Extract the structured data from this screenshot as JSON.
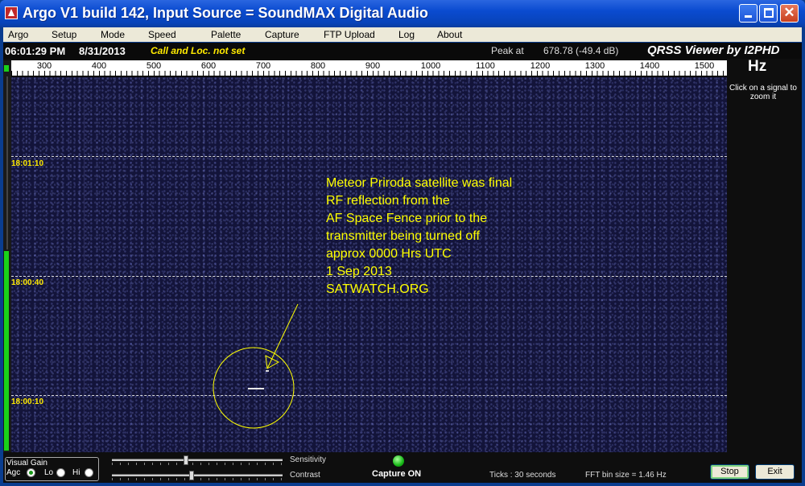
{
  "window": {
    "title": "Argo V1 build 142, Input Source = SoundMAX Digital Audio",
    "minimize_icon": "minimize-icon",
    "maximize_icon": "maximize-icon",
    "close_icon": "close-icon",
    "close_glyph": "✕"
  },
  "menu": {
    "items": [
      "Argo",
      "Setup",
      "Mode",
      "Speed",
      "Palette",
      "Capture",
      "FTP Upload",
      "Log",
      "About"
    ]
  },
  "status": {
    "time": "06:01:29 PM",
    "date": "8/31/2013",
    "call": "Call and Loc. not set",
    "peak_label": "Peak at",
    "peak_value": "678.78 (-49.4 dB)",
    "viewer": "QRSS Viewer by I2PHD"
  },
  "ruler": {
    "labels": [
      "300",
      "400",
      "500",
      "600",
      "700",
      "800",
      "900",
      "1000",
      "1100",
      "1200",
      "1300",
      "1400",
      "1500"
    ],
    "unit": "Hz",
    "hint": "Click on a signal to zoom it"
  },
  "waterfall": {
    "time_marks": [
      "18:01:10",
      "18:00:40",
      "18:00:10"
    ],
    "annotation_lines": [
      "Meteor Priroda satellite was final",
      "RF reflection from the",
      "AF Space Fence prior to the",
      "transmitter being turned off",
      "approx 0000 Hrs UTC",
      "1 Sep 2013",
      "SATWATCH.ORG"
    ],
    "annotation_color": "#ffff00"
  },
  "controls": {
    "visual_gain": "Visual Gain",
    "agc": "Agc",
    "lo": "Lo",
    "hi": "Hi",
    "agc_selected": true,
    "sensitivity": "Sensitivity",
    "contrast": "Contrast",
    "capture_status": "Capture ON",
    "ticks": "Ticks  : 30 seconds",
    "fft": "FFT bin size = 1.46 Hz",
    "stop": "Stop",
    "exit": "Exit"
  }
}
